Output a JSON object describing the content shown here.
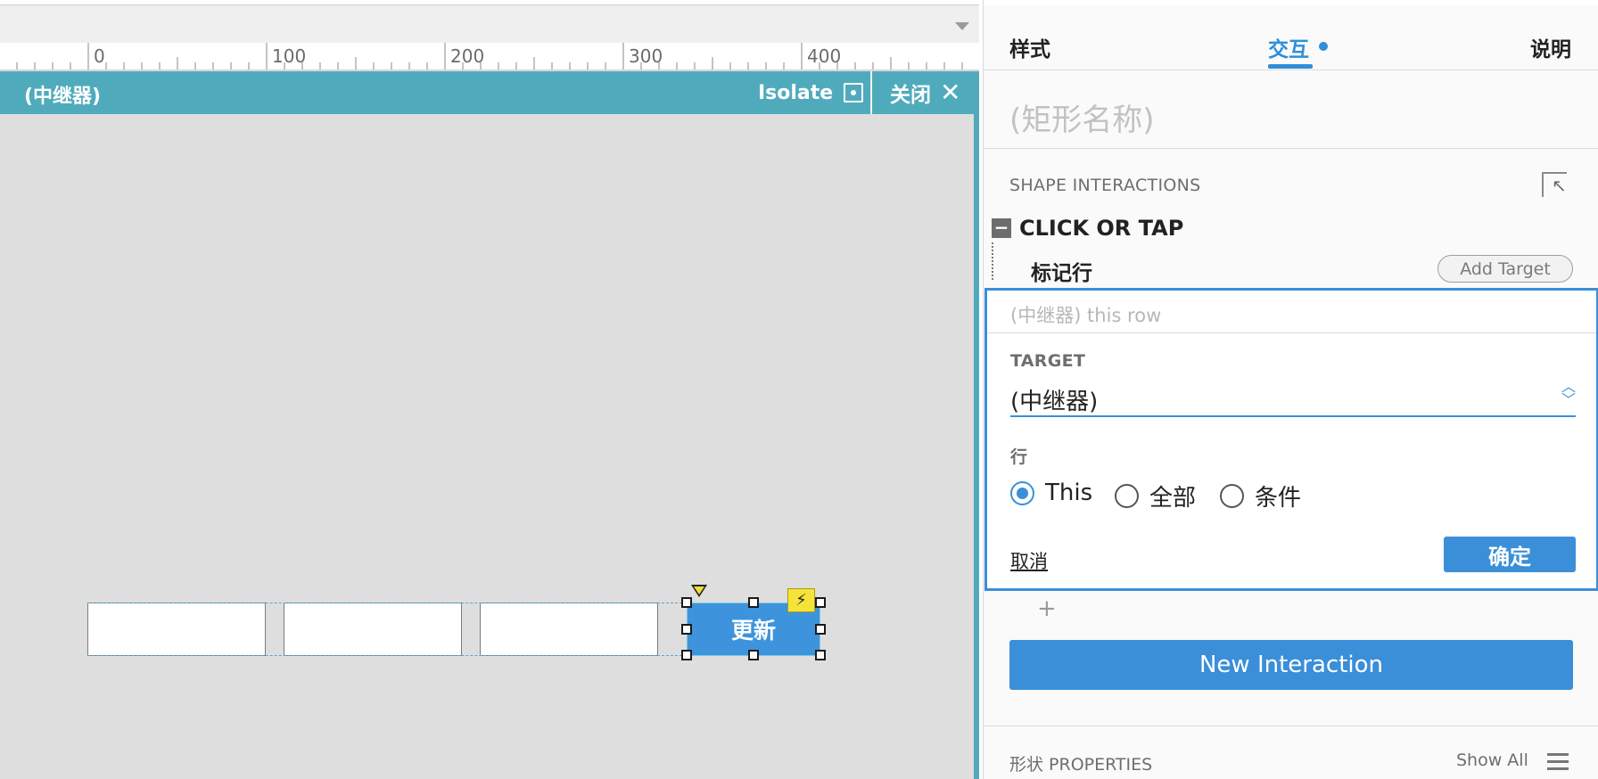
{
  "canvas": {
    "ruler_labels": [
      "0",
      "100",
      "200",
      "300",
      "400"
    ],
    "title": "(中继器)",
    "isolate_label": "Isolate",
    "close_label": "关闭",
    "close_glyph": "✕",
    "update_button_label": "更新",
    "bolt_glyph": "⚡"
  },
  "panel": {
    "tabs": [
      {
        "label": "样式"
      },
      {
        "label": "交互"
      },
      {
        "label": "说明"
      }
    ],
    "shape_name_placeholder": "(矩形名称)",
    "shape_interactions_title": "SHAPE INTERACTIONS",
    "collapse_glyph": "−",
    "event_name": "CLICK OR TAP",
    "action_name": "标记行",
    "add_target_label": "Add Target",
    "editor": {
      "summary": "(中继器) this row",
      "target_label": "TARGET",
      "target_value": "(中继器)",
      "target_arrows": "︿﹀",
      "row_label": "行",
      "options": [
        {
          "label": "This",
          "selected": true
        },
        {
          "label": "全部",
          "selected": false
        },
        {
          "label": "条件",
          "selected": false
        }
      ],
      "cancel_label": "取消",
      "ok_label": "确定"
    },
    "add_glyph": "+",
    "new_interaction_label": "New Interaction",
    "shape_properties_title": "形状 PROPERTIES",
    "show_all_label": "Show All"
  },
  "colors": {
    "accent": "#3a8fd8",
    "titlebar": "#4fabbc",
    "canvas_bg": "#dedede"
  }
}
